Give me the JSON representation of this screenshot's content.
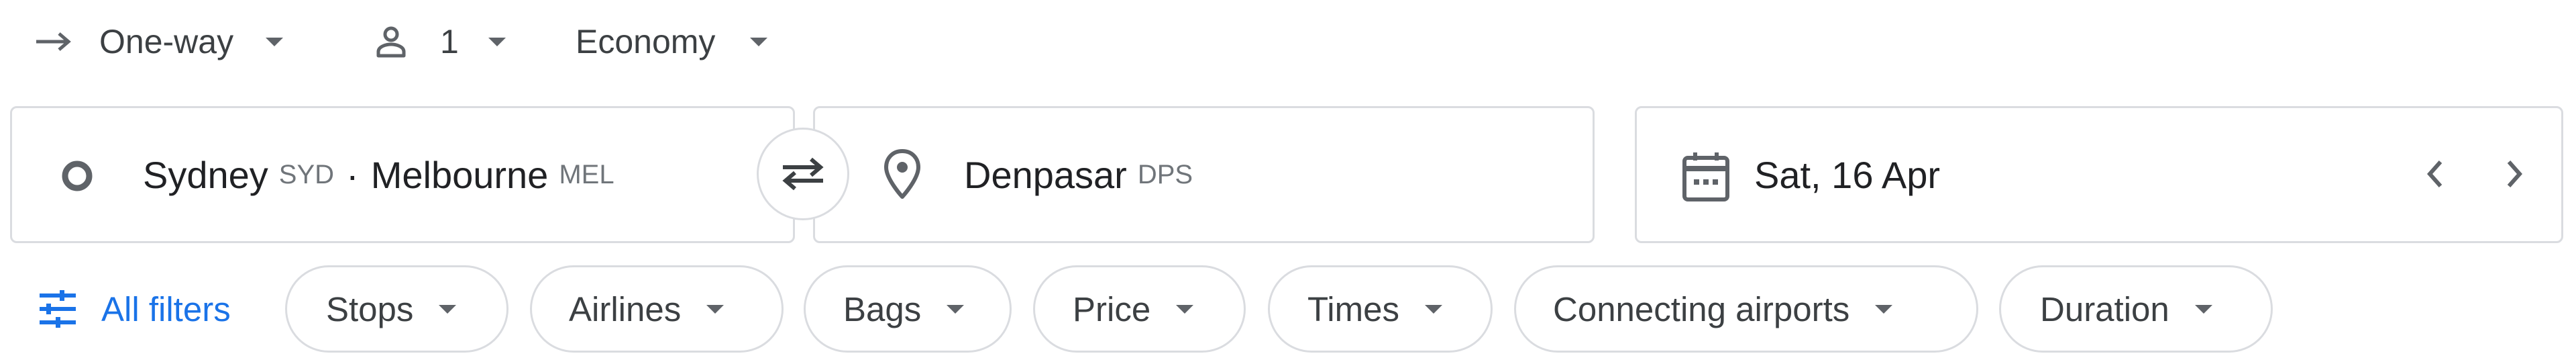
{
  "trip_options": {
    "trip_type": "One-way",
    "passengers": "1",
    "cabin_class": "Economy"
  },
  "origin": {
    "city1": "Sydney",
    "code1": "SYD",
    "separator": "·",
    "city2": "Melbourne",
    "code2": "MEL"
  },
  "destination": {
    "city": "Denpasar",
    "code": "DPS"
  },
  "date": {
    "departure": "Sat, 16 Apr"
  },
  "filters": {
    "all_filters_label": "All filters",
    "chips": [
      "Stops",
      "Airlines",
      "Bags",
      "Price",
      "Times",
      "Connecting airports",
      "Duration"
    ]
  },
  "colors": {
    "accent": "#1a73e8",
    "icon": "#5f6368",
    "border": "#dadce0",
    "text": "#3c4043"
  },
  "icons": {
    "trip_type": "arrow-right-icon",
    "passengers": "person-icon",
    "origin": "circle-icon",
    "swap": "swap-arrows-icon",
    "destination": "location-pin-icon",
    "date": "calendar-icon",
    "prev": "chevron-left-icon",
    "next": "chevron-right-icon",
    "filters": "tune-icon"
  }
}
